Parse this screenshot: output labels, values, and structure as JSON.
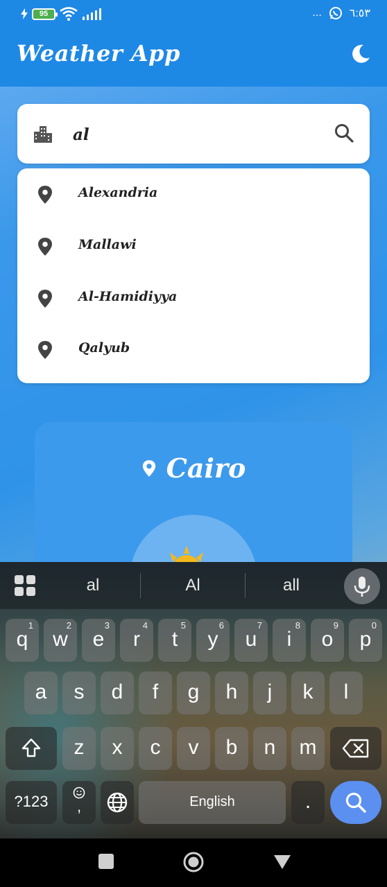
{
  "status_bar": {
    "battery": "95",
    "time": "٦:٥٣",
    "dots": "..."
  },
  "app_bar": {
    "title": "Weather App"
  },
  "search": {
    "value": "al"
  },
  "suggestions": [
    "Alexandria",
    "Mallawi",
    "Al-Hamidiyya",
    "Qalyub"
  ],
  "weather_card": {
    "city": "Cairo"
  },
  "keyboard": {
    "suggestions": [
      "al",
      "Al",
      "all"
    ],
    "row1": [
      {
        "k": "q",
        "n": "1"
      },
      {
        "k": "w",
        "n": "2"
      },
      {
        "k": "e",
        "n": "3"
      },
      {
        "k": "r",
        "n": "4"
      },
      {
        "k": "t",
        "n": "5"
      },
      {
        "k": "y",
        "n": "6"
      },
      {
        "k": "u",
        "n": "7"
      },
      {
        "k": "i",
        "n": "8"
      },
      {
        "k": "o",
        "n": "9"
      },
      {
        "k": "p",
        "n": "0"
      }
    ],
    "row2": [
      "a",
      "s",
      "d",
      "f",
      "g",
      "h",
      "j",
      "k",
      "l"
    ],
    "row3": [
      "z",
      "x",
      "c",
      "v",
      "b",
      "n",
      "m"
    ],
    "symbols_label": "?123",
    "emoji_comma": ",",
    "space_label": "English",
    "period": "."
  },
  "colors": {
    "primary": "#1e88e5",
    "card": "#3c9aec",
    "caret": "#7e57c2",
    "keyboard_action": "#5b8ff0"
  }
}
